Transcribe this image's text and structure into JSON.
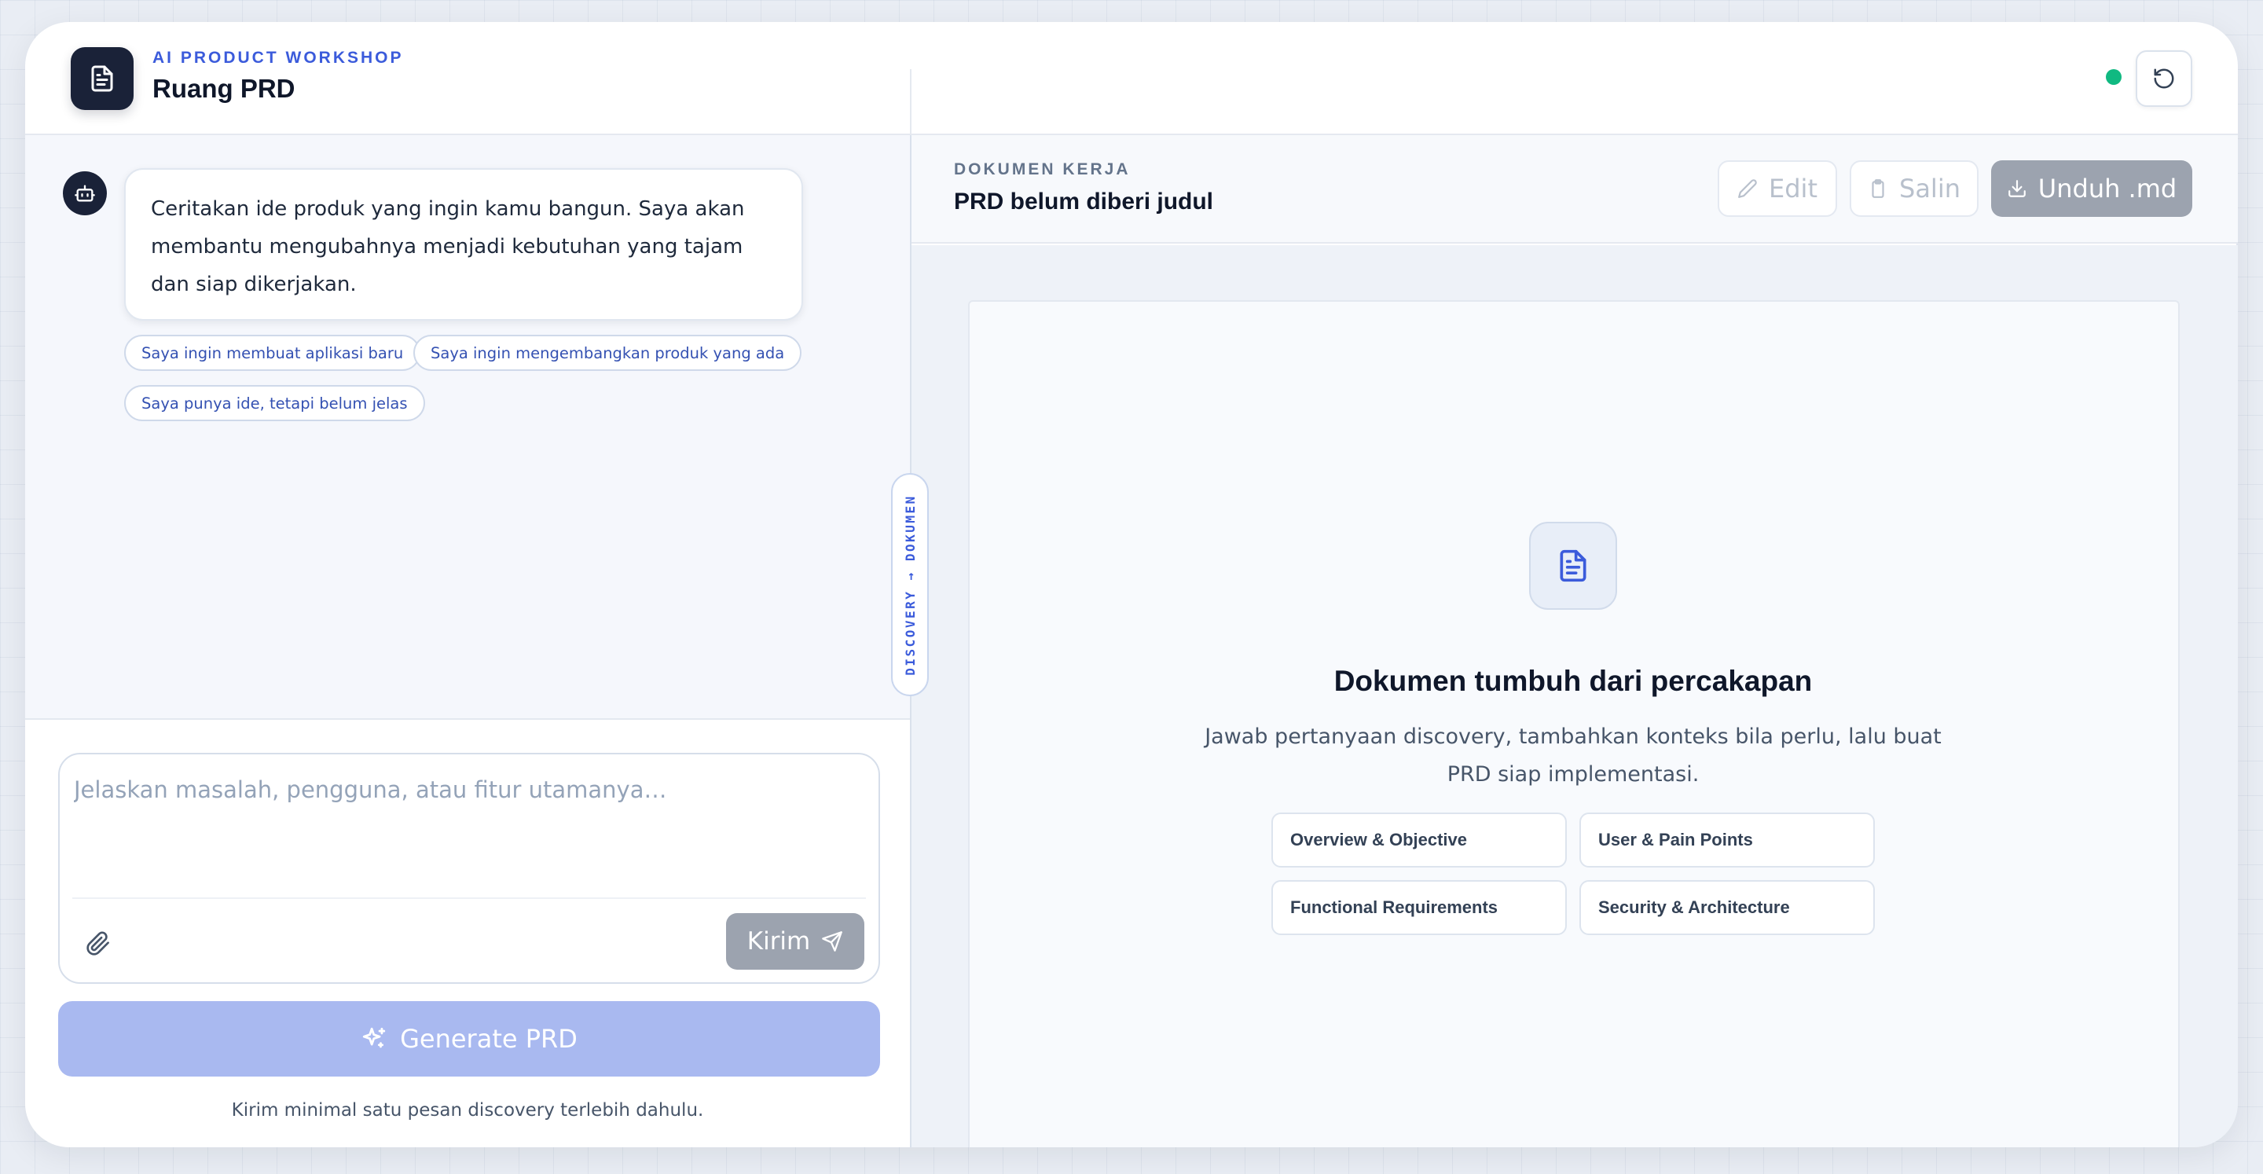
{
  "header": {
    "eyebrow": "AI PRODUCT WORKSHOP",
    "title": "Ruang PRD",
    "logo_icon": "document-icon",
    "status_color": "#10b981",
    "reset_icon": "refresh-icon"
  },
  "chat": {
    "bot_icon": "bot-icon",
    "welcome_message": "Ceritakan ide produk yang ingin kamu bangun. Saya akan membantu mengubahnya menjadi kebutuhan yang tajam dan siap dikerjakan.",
    "suggestions": [
      "Saya ingin membuat aplikasi baru",
      "Saya ingin mengembangkan produk yang ada",
      "Saya punya ide, tetapi belum jelas"
    ]
  },
  "composer": {
    "placeholder": "Jelaskan masalah, pengguna, atau fitur utamanya…",
    "value": "",
    "attach_icon": "paperclip-icon",
    "send_label": "Kirim",
    "send_icon": "send-icon"
  },
  "generate": {
    "label": "Generate PRD",
    "icon": "sparkles-icon",
    "hint": "Kirim minimal satu pesan discovery terlebih dahulu."
  },
  "divider_tab": {
    "label": "DISCOVERY → DOKUMEN"
  },
  "document": {
    "eyebrow": "DOKUMEN KERJA",
    "title": "PRD belum diberi judul",
    "toolbar": {
      "edit_label": "Edit",
      "copy_label": "Salin",
      "download_label": "Unduh .md"
    },
    "empty_state": {
      "icon": "document-icon",
      "title": "Dokumen tumbuh dari percakapan",
      "description": "Jawab pertanyaan discovery, tambahkan konteks bila perlu, lalu buat PRD siap implementasi.",
      "sections": [
        "Overview & Objective",
        "User & Pain Points",
        "Functional Requirements",
        "Security & Architecture"
      ]
    }
  },
  "colors": {
    "accent": "#3b5bdb",
    "dark": "#1a2238",
    "disabled_button": "#9ca3af",
    "generate_disabled": "#a9b9f0"
  }
}
